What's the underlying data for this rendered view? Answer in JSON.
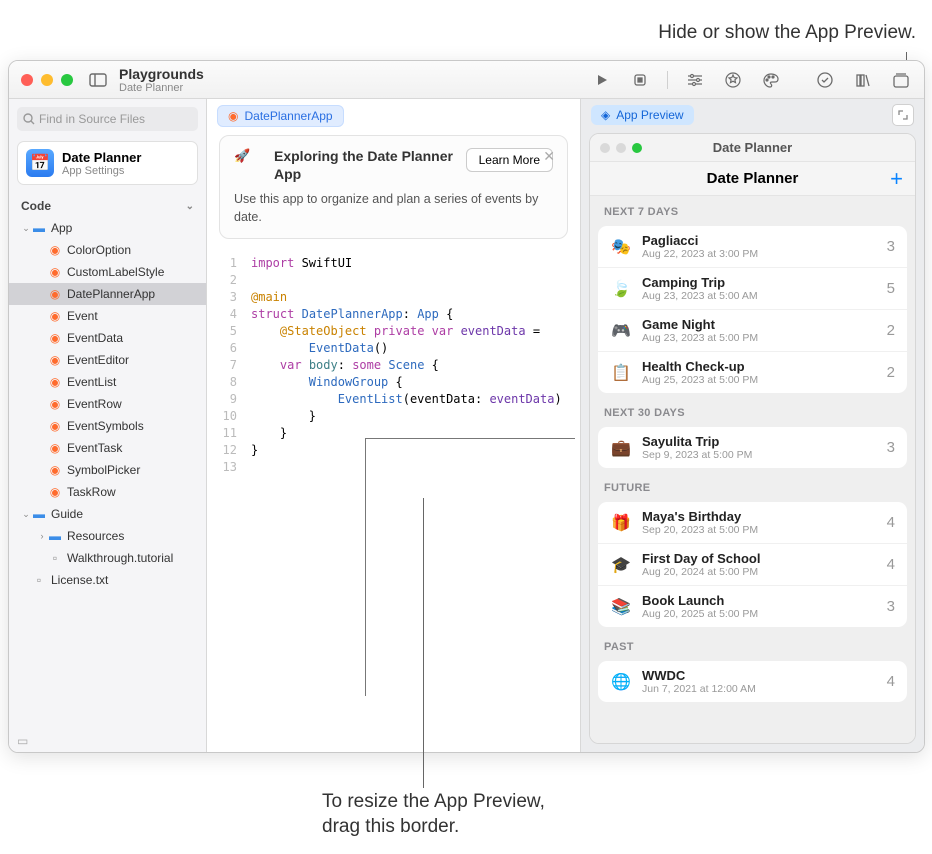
{
  "annotations": {
    "top": "Hide or show the App Preview.",
    "bottom_line1": "To resize the App Preview,",
    "bottom_line2": "drag this border."
  },
  "titlebar": {
    "title": "Playgrounds",
    "subtitle": "Date Planner"
  },
  "search": {
    "placeholder": "Find in Source Files"
  },
  "app_header": {
    "title": "Date Planner",
    "subtitle": "App Settings"
  },
  "sidebar": {
    "section": "Code",
    "items": [
      {
        "label": "App",
        "type": "folder",
        "depth": 0,
        "expanded": true
      },
      {
        "label": "ColorOption",
        "type": "swift",
        "depth": 1
      },
      {
        "label": "CustomLabelStyle",
        "type": "swift",
        "depth": 1
      },
      {
        "label": "DatePlannerApp",
        "type": "swift",
        "depth": 1,
        "selected": true
      },
      {
        "label": "Event",
        "type": "swift",
        "depth": 1
      },
      {
        "label": "EventData",
        "type": "swift",
        "depth": 1
      },
      {
        "label": "EventEditor",
        "type": "swift",
        "depth": 1
      },
      {
        "label": "EventList",
        "type": "swift",
        "depth": 1
      },
      {
        "label": "EventRow",
        "type": "swift",
        "depth": 1
      },
      {
        "label": "EventSymbols",
        "type": "swift",
        "depth": 1
      },
      {
        "label": "EventTask",
        "type": "swift",
        "depth": 1
      },
      {
        "label": "SymbolPicker",
        "type": "swift",
        "depth": 1
      },
      {
        "label": "TaskRow",
        "type": "swift",
        "depth": 1
      },
      {
        "label": "Guide",
        "type": "folder",
        "depth": 0,
        "expanded": true
      },
      {
        "label": "Resources",
        "type": "folder",
        "depth": 1,
        "expanded": false
      },
      {
        "label": "Walkthrough.tutorial",
        "type": "doc",
        "depth": 1
      },
      {
        "label": "License.txt",
        "type": "doc",
        "depth": 0
      }
    ]
  },
  "breadcrumb": {
    "label": "DatePlannerApp"
  },
  "info_card": {
    "title": "Exploring the Date Planner App",
    "desc": "Use this app to organize and plan a series of events by date.",
    "learn_more": "Learn More"
  },
  "code": {
    "lines": [
      {
        "n": 1,
        "html": "<span class='kw'>import</span> SwiftUI"
      },
      {
        "n": 2,
        "html": ""
      },
      {
        "n": 3,
        "html": "<span class='at'>@main</span>"
      },
      {
        "n": 4,
        "html": "<span class='kw'>struct</span> <span class='ty'>DatePlannerApp</span>: <span class='ty'>App</span> {"
      },
      {
        "n": 5,
        "html": "    <span class='at'>@StateObject</span> <span class='kw'>private var</span> <span class='id'>eventData</span> ="
      },
      {
        "n": 6,
        "html": "        <span class='ty'>EventData</span>()"
      },
      {
        "n": 7,
        "html": "    <span class='kw'>var</span> <span class='pr'>body</span>: <span class='kw'>some</span> <span class='ty'>Scene</span> {"
      },
      {
        "n": 8,
        "html": "        <span class='ty'>WindowGroup</span> {"
      },
      {
        "n": 9,
        "html": "            <span class='ty'>EventList</span>(eventData: <span class='id'>eventData</span>)"
      },
      {
        "n": 10,
        "html": "        }"
      },
      {
        "n": 11,
        "html": "    }"
      },
      {
        "n": 12,
        "html": "}"
      },
      {
        "n": 13,
        "html": ""
      }
    ]
  },
  "preview": {
    "label": "App Preview",
    "window_title": "Date Planner",
    "nav_title": "Date Planner",
    "sections": [
      {
        "header": "NEXT 7 DAYS",
        "rows": [
          {
            "icon": "🎭",
            "color": "#f5b400",
            "title": "Pagliacci",
            "sub": "Aug 22, 2023 at 3:00 PM",
            "count": "3"
          },
          {
            "icon": "🍃",
            "color": "#34c759",
            "title": "Camping Trip",
            "sub": "Aug 23, 2023 at 5:00 AM",
            "count": "5"
          },
          {
            "icon": "🎮",
            "color": "#0a84ff",
            "title": "Game Night",
            "sub": "Aug 23, 2023 at 5:00 PM",
            "count": "2"
          },
          {
            "icon": "📋",
            "color": "#5856d6",
            "title": "Health Check-up",
            "sub": "Aug 25, 2023 at 5:00 PM",
            "count": "2"
          }
        ]
      },
      {
        "header": "NEXT 30 DAYS",
        "rows": [
          {
            "icon": "💼",
            "color": "#ff9500",
            "title": "Sayulita Trip",
            "sub": "Sep 9, 2023 at 5:00 PM",
            "count": "3"
          }
        ]
      },
      {
        "header": "FUTURE",
        "rows": [
          {
            "icon": "🎁",
            "color": "#ff3b30",
            "title": "Maya's Birthday",
            "sub": "Sep 20, 2023 at 5:00 PM",
            "count": "4"
          },
          {
            "icon": "🎓",
            "color": "#000",
            "title": "First Day of School",
            "sub": "Aug 20, 2024 at 5:00 PM",
            "count": "4"
          },
          {
            "icon": "📚",
            "color": "#af52de",
            "title": "Book Launch",
            "sub": "Aug 20, 2025 at 5:00 PM",
            "count": "3"
          }
        ]
      },
      {
        "header": "PAST",
        "rows": [
          {
            "icon": "🌐",
            "color": "#8e8e93",
            "title": "WWDC",
            "sub": "Jun 7, 2021 at 12:00 AM",
            "count": "4"
          }
        ]
      }
    ]
  }
}
